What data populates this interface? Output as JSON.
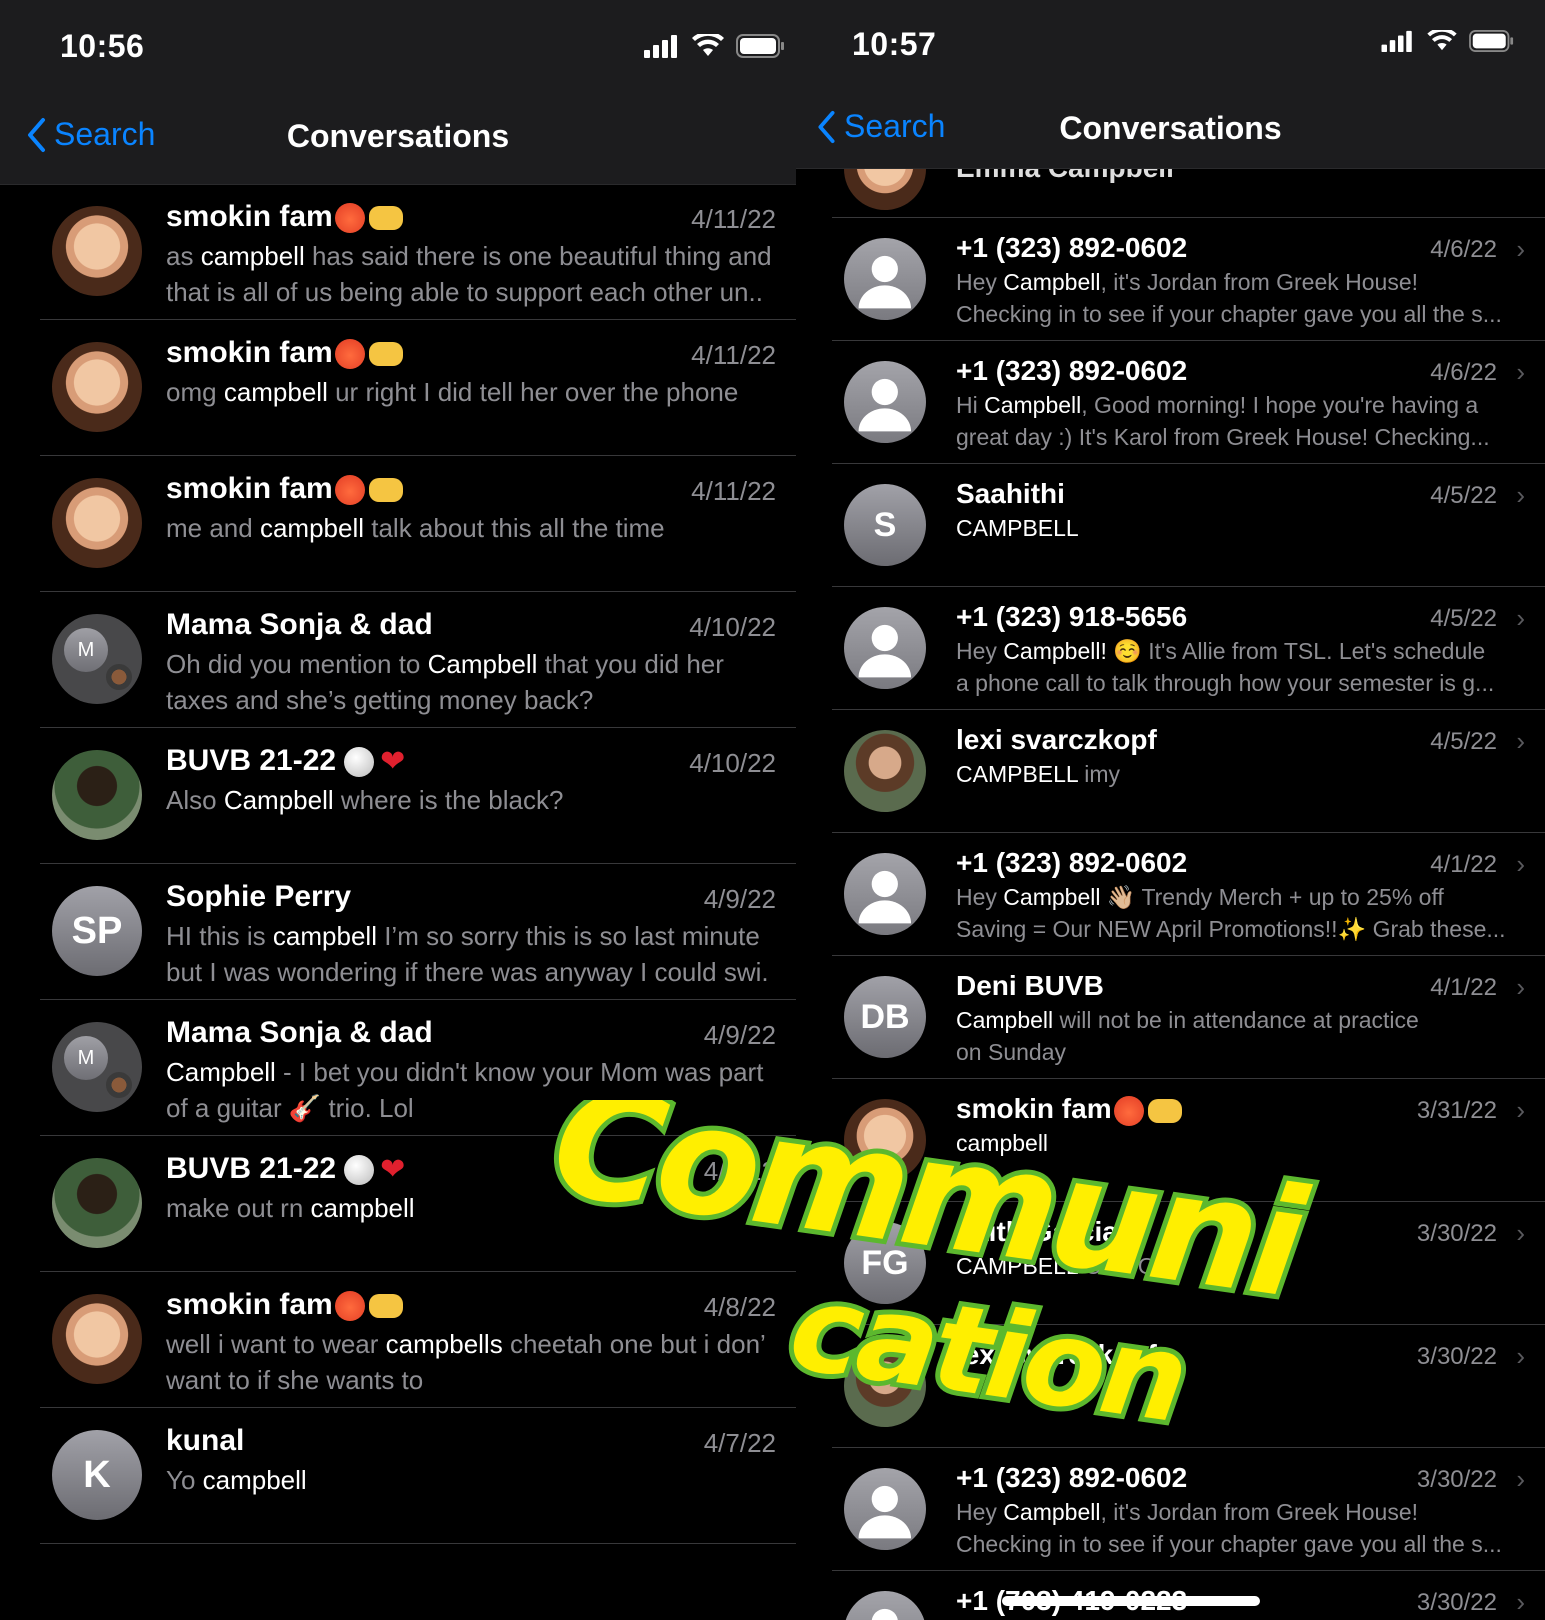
{
  "left": {
    "status": {
      "time": "10:56"
    },
    "nav": {
      "back_label": "Search",
      "title": "Conversations"
    },
    "rows": [
      {
        "avatar": "face-photo",
        "name": "smokin fam",
        "emoji": [
          "face",
          "hand"
        ],
        "date": "4/11/22",
        "msg": [
          [
            "as ",
            "campbell",
            " has said there is one beautiful thing and"
          ],
          [
            "that is all of us being able to support each other un.."
          ]
        ]
      },
      {
        "avatar": "face-photo",
        "name": "smokin fam",
        "emoji": [
          "face",
          "hand"
        ],
        "date": "4/11/22",
        "msg": [
          [
            "omg ",
            "campbell",
            " ur right I did tell her over the phone"
          ]
        ]
      },
      {
        "avatar": "face-photo",
        "name": "smokin fam",
        "emoji": [
          "face",
          "hand"
        ],
        "date": "4/11/22",
        "msg": [
          [
            "me and ",
            "campbell",
            " talk about this all the time"
          ]
        ]
      },
      {
        "avatar": "group",
        "initial": "M",
        "name": "Mama Sonja & dad",
        "date": "4/10/22",
        "msg": [
          [
            "Oh did you mention to ",
            "Campbell",
            " that you did her"
          ],
          [
            "taxes and she’s getting money back?"
          ]
        ]
      },
      {
        "avatar": "team-photo",
        "name": "BUVB 21-22",
        "emoji": [
          "ball",
          "heart"
        ],
        "date": "4/10/22",
        "msg": [
          [
            "Also ",
            "Campbell",
            " where is the black?"
          ]
        ]
      },
      {
        "avatar": "initials",
        "initial": "SP",
        "name": "Sophie Perry",
        "date": "4/9/22",
        "msg": [
          [
            "HI this is ",
            "campbell",
            " I’m so sorry this is so last minute"
          ],
          [
            "but I was wondering if there was anyway I could swi."
          ]
        ]
      },
      {
        "avatar": "group",
        "initial": "M",
        "name": "Mama Sonja & dad",
        "date": "4/9/22",
        "msg": [
          [
            "",
            "Campbell",
            " - I bet you didn't know your Mom was part"
          ],
          [
            "of a guitar 🎸 trio. Lol"
          ]
        ]
      },
      {
        "avatar": "team-photo",
        "name": "BUVB 21-22",
        "emoji": [
          "ball",
          "heart"
        ],
        "date": "4/8/22",
        "msg": [
          [
            "make out rn ",
            "campbell",
            ""
          ]
        ]
      },
      {
        "avatar": "face-photo",
        "name": "smokin fam",
        "emoji": [
          "face",
          "hand"
        ],
        "date": "4/8/22",
        "msg": [
          [
            "well i want to wear ",
            "campbells",
            " cheetah one but i don’"
          ],
          [
            "want to if she wants to"
          ]
        ]
      },
      {
        "avatar": "initials",
        "initial": "K",
        "name": "kunal",
        "date": "4/7/22",
        "msg": [
          [
            "Yo ",
            "campbell",
            ""
          ]
        ]
      }
    ]
  },
  "right": {
    "status": {
      "time": "10:57"
    },
    "nav": {
      "back_label": "Search",
      "title": "Conversations"
    },
    "top_partial_name": "Emma Campbell",
    "rows": [
      {
        "avatar": "person",
        "name": "+1 (323) 892-0602",
        "date": "4/6/22",
        "msg": [
          [
            "Hey ",
            "Campbell",
            ",  it's Jordan from Greek House!"
          ],
          [
            "Checking in to see if your chapter gave you all the s..."
          ]
        ]
      },
      {
        "avatar": "person",
        "name": "+1 (323) 892-0602",
        "date": "4/6/22",
        "msg": [
          [
            "Hi ",
            "Campbell",
            ",   Good morning! I hope you're having a"
          ],
          [
            "great day :)   It's Karol from Greek House! Checking..."
          ]
        ]
      },
      {
        "avatar": "initials",
        "initial": "S",
        "name": "Saahithi",
        "date": "4/5/22",
        "msg": [
          [
            "",
            "CAMPBELL",
            ""
          ]
        ]
      },
      {
        "avatar": "person",
        "name": "+1 (323) 918-5656",
        "date": "4/5/22",
        "msg": [
          [
            "Hey ",
            "Campbell!",
            " ☺️  It's Allie from TSL. Let's schedule"
          ],
          [
            "a phone call to talk through how your semester is g..."
          ]
        ]
      },
      {
        "avatar": "lexi-photo",
        "name": "lexi svarczkopf",
        "date": "4/5/22",
        "msg": [
          [
            "",
            "CAMPBELL",
            " imy"
          ]
        ]
      },
      {
        "avatar": "person",
        "name": "+1 (323) 892-0602",
        "date": "4/1/22",
        "msg": [
          [
            "Hey ",
            "Campbell",
            " 👋🏼 Trendy Merch + up to 25% off"
          ],
          [
            "Saving = Our NEW April Promotions!!✨  Grab these..."
          ]
        ]
      },
      {
        "avatar": "initials",
        "initial": "DB",
        "name": "Deni BUVB",
        "date": "4/1/22",
        "msg": [
          [
            "",
            "Campbell",
            " will not be in attendance at practice"
          ],
          [
            "on Sunday"
          ]
        ]
      },
      {
        "avatar": "face-photo",
        "name": "smokin fam",
        "emoji": [
          "face",
          "hand"
        ],
        "date": "3/31/22",
        "msg": [
          [
            "",
            "campbell",
            ""
          ]
        ]
      },
      {
        "avatar": "initials",
        "initial": "FG",
        "name": "Faith Garcia",
        "date": "3/30/22",
        "msg": [
          [
            "",
            "CAMPBELL",
            " OOOO"
          ]
        ]
      },
      {
        "avatar": "lexi-photo",
        "name": "lexi svarczkopf",
        "date": "3/30/22",
        "msg": [
          [
            "",
            "",
            ""
          ]
        ]
      },
      {
        "avatar": "person",
        "name": "+1 (323) 892-0602",
        "date": "3/30/22",
        "msg": [
          [
            "Hey ",
            "Campbell",
            ",  it's Jordan from Greek House!"
          ],
          [
            "Checking in to see if your chapter gave you all the s..."
          ]
        ]
      },
      {
        "avatar": "person",
        "name": "+1 (703) 419-0223",
        "date": "3/30/22",
        "msg": []
      }
    ]
  },
  "sticker": {
    "line1": "Communi",
    "line2": "cation"
  },
  "colors": {
    "accent": "#0a84ff",
    "secondary_text": "#8e8e93",
    "bar": "#1c1c1e",
    "sticker_yellow": "#ffef00",
    "sticker_green": "#5cb82e"
  }
}
